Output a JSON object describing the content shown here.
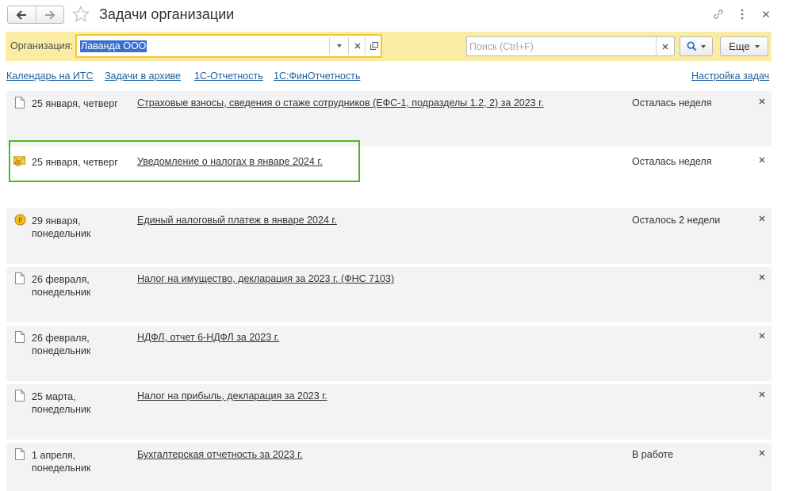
{
  "header": {
    "title": "Задачи организации",
    "icons": {
      "back": "arrow-left-icon",
      "forward": "arrow-right-icon",
      "favorite": "star-icon",
      "link": "link-icon",
      "menu": "more-vertical-icon",
      "close": "close-icon"
    }
  },
  "filter": {
    "organization_label": "Организация:",
    "organization_value": "Лаванда ООО",
    "search_placeholder": "Поиск (Ctrl+F)",
    "search_value": "",
    "more_label": "Еще"
  },
  "links": {
    "calendar": "Календарь на ИТС",
    "archive": "Задачи в архиве",
    "reporting": "1С-Отчетность",
    "fin_reporting": "1С:ФинОтчетность",
    "settings": "Настройка задач"
  },
  "tasks": [
    {
      "icon": "document-icon",
      "date": "25 января, четверг",
      "title": "Страховые взносы, сведения о стаже сотрудников (ЕФС-1, подразделы 1.2, 2) за 2023 г.",
      "status": "Осталась неделя"
    },
    {
      "icon": "mail-coin-icon",
      "date": "25 января, четверг",
      "title": "Уведомление о налогах в январе 2024 г.",
      "status": "Осталась неделя"
    },
    {
      "icon": "ruble-coin-icon",
      "date": "29 января, понедельник",
      "title": "Единый налоговый платеж в январе 2024 г.",
      "status": "Осталось 2 недели"
    },
    {
      "icon": "document-icon",
      "date": "26 февраля, понедельник",
      "title": "Налог на имущество, декларация за 2023 г. (ФНС 7103)",
      "status": ""
    },
    {
      "icon": "document-icon",
      "date": "26 февраля, понедельник",
      "title": "НДФЛ, отчет 6-НДФЛ за 2023 г.",
      "status": ""
    },
    {
      "icon": "document-icon",
      "date": "25 марта, понедельник",
      "title": "Налог на прибыль, декларация за 2023 г.",
      "status": ""
    },
    {
      "icon": "document-icon",
      "date": "1 апреля, понедельник",
      "title": "Бухгалтерская отчетность за 2023 г.",
      "status": "В работе"
    }
  ],
  "colors": {
    "filter_bar": "#fbeca4",
    "field_focus": "#f4c534",
    "link": "#1d5f9c",
    "highlight": "#4fb52b",
    "selection": "#3a6fcc",
    "row_bg": "#f3f3f3"
  }
}
